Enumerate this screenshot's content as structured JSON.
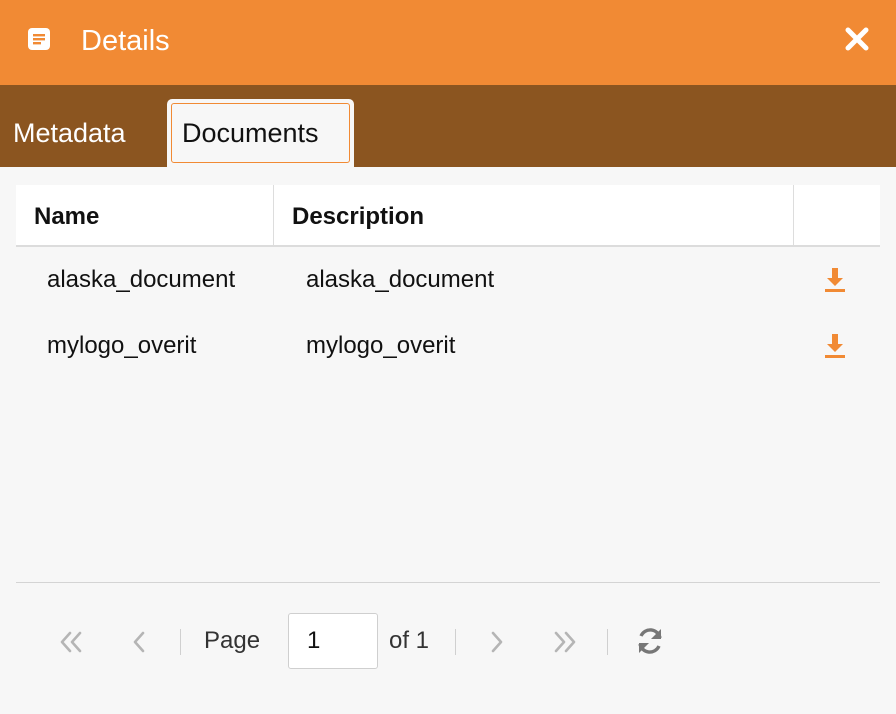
{
  "window": {
    "title": "Details",
    "title_icon": "document-icon",
    "close_icon": "close-icon",
    "accent_color": "#f18a34",
    "tabbar_color": "#8b5520"
  },
  "tabs": [
    {
      "label": "Metadata",
      "active": false
    },
    {
      "label": "Documents",
      "active": true
    }
  ],
  "grid": {
    "columns": [
      "Name",
      "Description",
      ""
    ],
    "rows": [
      {
        "name": "alaska_document",
        "description": "alaska_document",
        "action_icon": "download-icon"
      },
      {
        "name": "mylogo_overit",
        "description": "mylogo_overit",
        "action_icon": "download-icon"
      }
    ]
  },
  "pager": {
    "page_label": "Page",
    "page_value": "1",
    "of_label": "of 1",
    "icons": [
      "first-page-icon",
      "prev-page-icon",
      "next-page-icon",
      "last-page-icon",
      "refresh-icon"
    ]
  }
}
